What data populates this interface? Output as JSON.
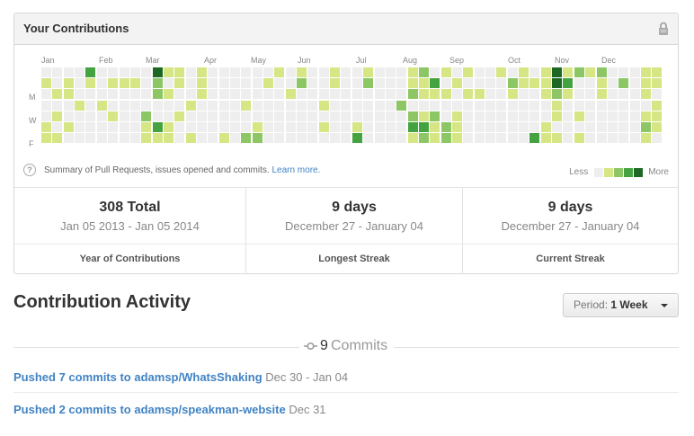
{
  "box": {
    "title": "Your Contributions",
    "lock_icon": "lock-icon"
  },
  "calendar": {
    "months": [
      "Jan",
      "Feb",
      "Mar",
      "Apr",
      "May",
      "Jun",
      "Jul",
      "Aug",
      "Sep",
      "Oct",
      "Nov",
      "Dec"
    ],
    "day_labels": [
      "M",
      "W",
      "F"
    ],
    "colors": [
      "#eeeeee",
      "#d6e685",
      "#8cc665",
      "#44a340",
      "#1e6823"
    ],
    "weeks": [
      [
        0,
        1,
        0,
        0,
        0,
        1,
        1
      ],
      [
        0,
        0,
        1,
        0,
        1,
        0,
        1
      ],
      [
        0,
        1,
        1,
        0,
        0,
        1,
        0
      ],
      [
        0,
        0,
        0,
        1,
        0,
        0,
        0
      ],
      [
        3,
        1,
        0,
        0,
        0,
        0,
        0
      ],
      [
        0,
        0,
        0,
        1,
        0,
        0,
        0
      ],
      [
        0,
        1,
        0,
        0,
        1,
        0,
        0
      ],
      [
        0,
        1,
        0,
        0,
        0,
        0,
        0
      ],
      [
        0,
        1,
        0,
        0,
        0,
        0,
        0
      ],
      [
        0,
        0,
        0,
        0,
        2,
        1,
        1
      ],
      [
        4,
        2,
        2,
        0,
        0,
        3,
        1
      ],
      [
        1,
        0,
        1,
        0,
        0,
        1,
        1
      ],
      [
        1,
        1,
        0,
        0,
        1,
        0,
        0
      ],
      [
        0,
        0,
        0,
        1,
        0,
        0,
        1
      ],
      [
        1,
        1,
        1,
        0,
        0,
        0,
        0
      ],
      [
        0,
        0,
        0,
        0,
        0,
        0,
        0
      ],
      [
        0,
        0,
        0,
        0,
        0,
        0,
        1
      ],
      [
        0,
        0,
        0,
        0,
        0,
        0,
        0
      ],
      [
        0,
        0,
        0,
        1,
        0,
        0,
        2
      ],
      [
        0,
        0,
        0,
        0,
        0,
        1,
        2
      ],
      [
        0,
        1,
        0,
        0,
        0,
        0,
        0
      ],
      [
        1,
        0,
        0,
        0,
        0,
        0,
        0
      ],
      [
        0,
        0,
        1,
        0,
        0,
        0,
        0
      ],
      [
        1,
        2,
        0,
        0,
        0,
        0,
        0
      ],
      [
        0,
        0,
        0,
        0,
        0,
        0,
        0
      ],
      [
        0,
        0,
        0,
        1,
        0,
        1,
        0
      ],
      [
        1,
        1,
        0,
        0,
        0,
        0,
        0
      ],
      [
        0,
        0,
        0,
        0,
        0,
        0,
        0
      ],
      [
        0,
        0,
        0,
        0,
        0,
        1,
        3
      ],
      [
        1,
        2,
        0,
        0,
        0,
        0,
        0
      ],
      [
        0,
        0,
        0,
        0,
        0,
        0,
        0
      ],
      [
        0,
        0,
        0,
        0,
        0,
        0,
        0
      ],
      [
        0,
        0,
        0,
        2,
        0,
        0,
        0
      ],
      [
        1,
        1,
        2,
        0,
        2,
        3,
        1
      ],
      [
        2,
        1,
        1,
        0,
        1,
        3,
        2
      ],
      [
        0,
        3,
        1,
        0,
        2,
        1,
        1
      ],
      [
        1,
        0,
        1,
        0,
        0,
        2,
        2
      ],
      [
        0,
        1,
        0,
        0,
        1,
        1,
        1
      ],
      [
        1,
        0,
        1,
        0,
        0,
        0,
        0
      ],
      [
        0,
        0,
        1,
        0,
        0,
        0,
        0
      ],
      [
        0,
        0,
        0,
        0,
        0,
        0,
        0
      ],
      [
        1,
        0,
        0,
        0,
        0,
        0,
        0
      ],
      [
        0,
        2,
        1,
        0,
        0,
        0,
        0
      ],
      [
        1,
        1,
        0,
        0,
        0,
        0,
        0
      ],
      [
        0,
        1,
        0,
        0,
        0,
        0,
        3
      ],
      [
        1,
        1,
        1,
        0,
        0,
        1,
        1
      ],
      [
        4,
        4,
        2,
        1,
        1,
        0,
        1
      ],
      [
        1,
        3,
        1,
        0,
        0,
        0,
        0
      ],
      [
        2,
        0,
        0,
        0,
        1,
        0,
        1
      ],
      [
        1,
        0,
        0,
        0,
        0,
        0,
        0
      ],
      [
        2,
        1,
        1,
        0,
        0,
        0,
        0
      ],
      [
        0,
        0,
        0,
        0,
        0,
        0,
        0
      ],
      [
        0,
        2,
        0,
        0,
        0,
        0,
        0
      ],
      [
        0,
        0,
        0,
        0,
        0,
        0,
        0
      ],
      [
        1,
        1,
        1,
        0,
        1,
        2,
        1
      ],
      [
        1,
        1,
        0,
        1,
        1,
        1,
        0
      ]
    ],
    "note": "Summary of Pull Requests, issues opened and commits.",
    "learn_more": "Learn more.",
    "legend_less": "Less",
    "legend_more": "More",
    "help_icon": "question-circle-icon"
  },
  "stats": [
    {
      "big": "308 Total",
      "sub": "Jan 05 2013 - Jan 05 2014",
      "foot": "Year of Contributions"
    },
    {
      "big": "9 days",
      "sub": "December 27 - January 04",
      "foot": "Longest Streak"
    },
    {
      "big": "9 days",
      "sub": "December 27 - January 04",
      "foot": "Current Streak"
    }
  ],
  "activity": {
    "title": "Contribution Activity",
    "period_label": "Period:",
    "period_value": "1 Week",
    "commit_count": "9",
    "commit_word": "Commits",
    "commit_icon": "git-commit-icon",
    "pushes": [
      {
        "link": "Pushed 7 commits to adamsp/WhatsShaking",
        "date": "Dec 30 - Jan 04"
      },
      {
        "link": "Pushed 2 commits to adamsp/speakman-website",
        "date": "Dec 31"
      }
    ]
  }
}
